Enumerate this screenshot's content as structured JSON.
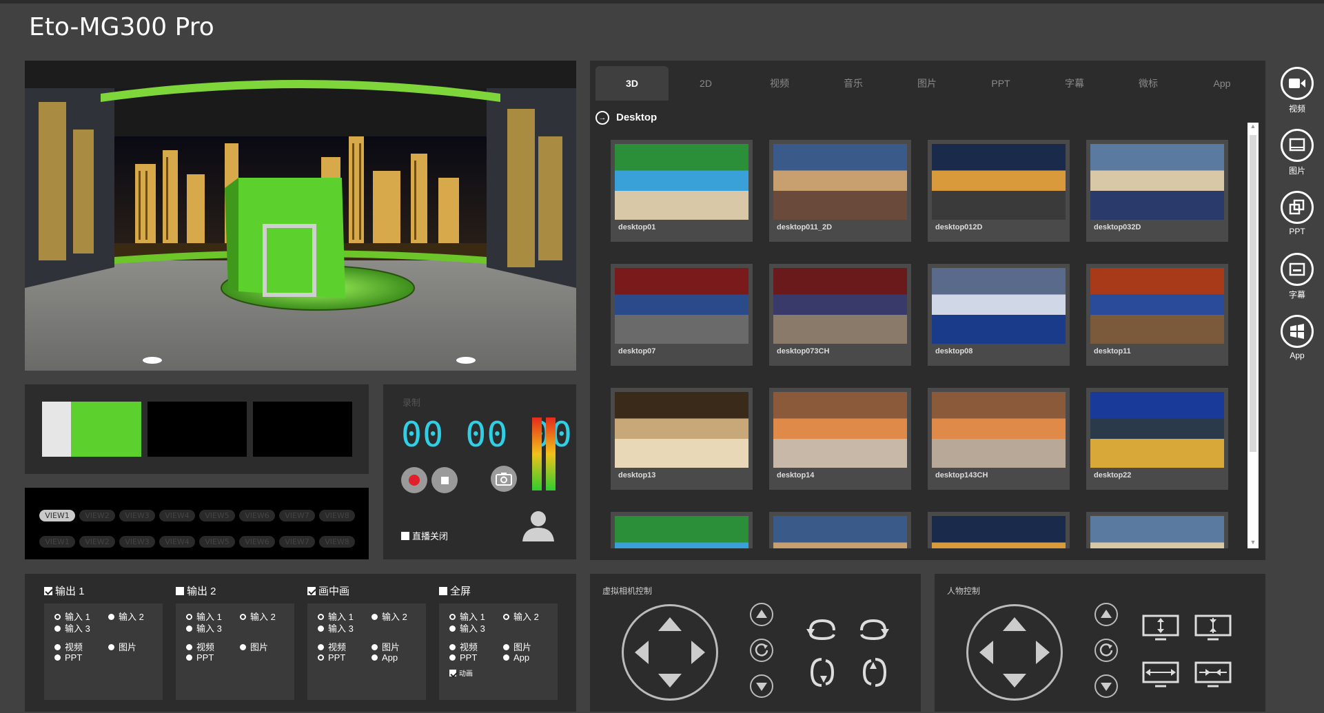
{
  "app": {
    "title": "Eto-MG300 Pro"
  },
  "preview": {
    "label": "virtual-studio-preview"
  },
  "record": {
    "label": "录制",
    "timer": "00 00 00",
    "live_label": "直播关闭"
  },
  "views": {
    "row1": [
      "VIEW1",
      "VIEW2",
      "VIEW3",
      "VIEW4",
      "VIEW5",
      "VIEW6",
      "VIEW7",
      "VIEW8"
    ],
    "row2": [
      "VIEW1",
      "VIEW2",
      "VIEW3",
      "VIEW4",
      "VIEW5",
      "VIEW6",
      "VIEW7",
      "VIEW8"
    ],
    "active": "VIEW1"
  },
  "tabs": [
    "3D",
    "2D",
    "视频",
    "音乐",
    "图片",
    "PPT",
    "字幕",
    "微标",
    "App"
  ],
  "active_tab": "3D",
  "breadcrumb": "Desktop",
  "thumbnails": [
    "desktop01",
    "desktop011_2D",
    "desktop012D",
    "desktop032D",
    "desktop07",
    "desktop073CH",
    "desktop08",
    "desktop11",
    "desktop13",
    "desktop14",
    "desktop143CH",
    "desktop22"
  ],
  "sidebar": [
    {
      "label": "视频",
      "icon": "video-camera-icon"
    },
    {
      "label": "图片",
      "icon": "image-icon"
    },
    {
      "label": "PPT",
      "icon": "ppt-icon"
    },
    {
      "label": "字幕",
      "icon": "subtitle-icon"
    },
    {
      "label": "App",
      "icon": "windows-app-icon"
    }
  ],
  "outputs": [
    {
      "title": "输出 1",
      "checked": true,
      "in1": "输入 1",
      "in2": "输入 2",
      "in3": "输入 3",
      "video": "视频",
      "image": "图片",
      "ppt": "PPT"
    },
    {
      "title": "输出 2",
      "checked": false,
      "in1": "输入 1",
      "in2": "输入 2",
      "in3": "输入 3",
      "video": "视频",
      "image": "图片",
      "ppt": "PPT"
    },
    {
      "title": "画中画",
      "checked": true,
      "in1": "输入 1",
      "in2": "输入 2",
      "in3": "输入 3",
      "video": "视频",
      "image": "图片",
      "ppt": "PPT",
      "app": "App"
    },
    {
      "title": "全屏",
      "checked": false,
      "in1": "输入 1",
      "in2": "输入 2",
      "in3": "输入 3",
      "video": "视频",
      "image": "图片",
      "ppt": "PPT",
      "app": "App",
      "anim": "动画"
    }
  ],
  "camera_control": {
    "label": "虚拟相机控制"
  },
  "person_control": {
    "label": "人物控制"
  },
  "colors": {
    "accent": "#2fd0e6",
    "record_red": "#e0202a",
    "green_screen": "#5cd12e"
  }
}
